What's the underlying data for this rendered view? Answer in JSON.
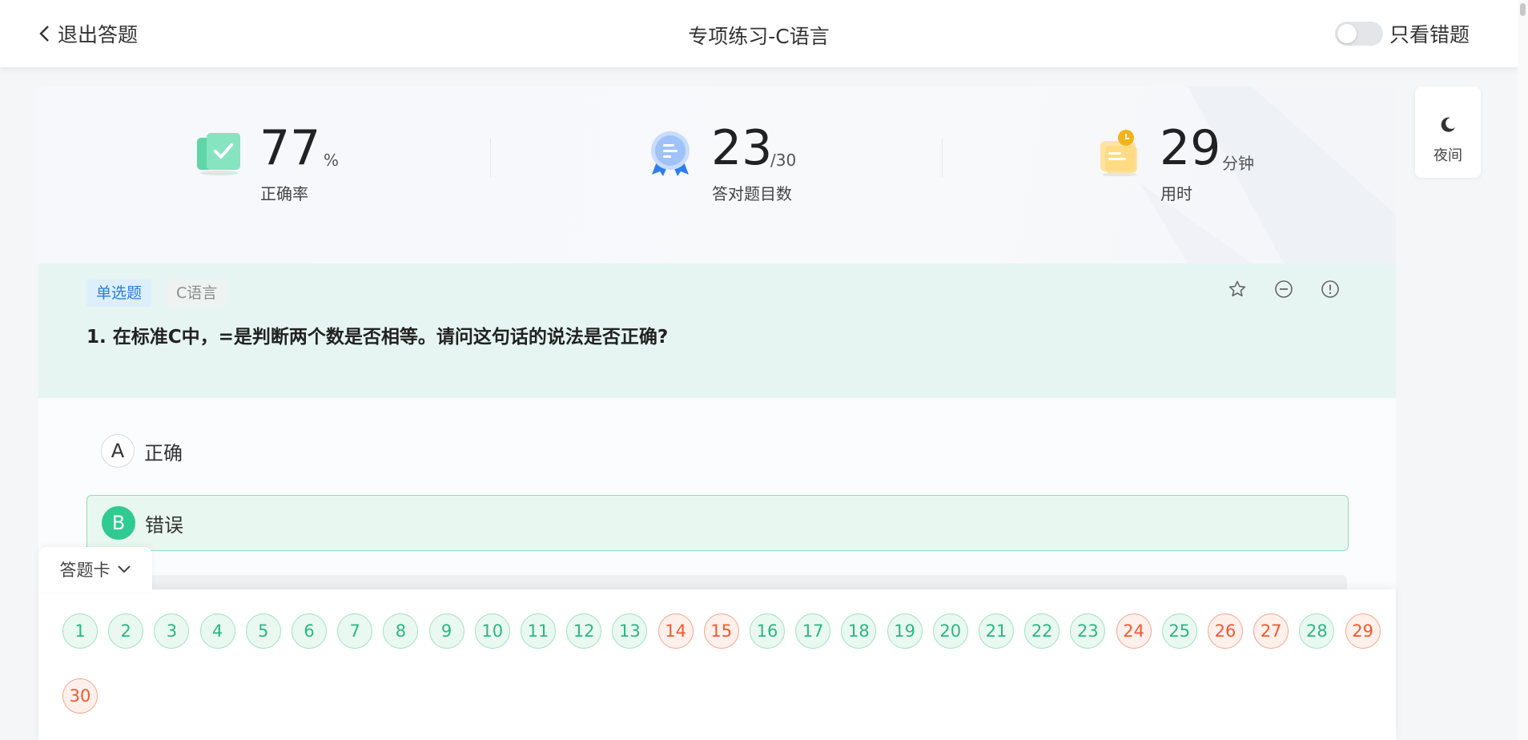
{
  "header": {
    "back_label": "退出答题",
    "title": "专项练习-C语言",
    "toggle_label": "只看错题",
    "toggle_on": false
  },
  "stats": {
    "accuracy": {
      "value": "77",
      "unit": "%",
      "caption": "正确率"
    },
    "correct_count": {
      "value": "23",
      "unit": "/30",
      "caption": "答对题目数"
    },
    "time_used": {
      "value": "29",
      "unit": "分钟",
      "caption": "用时"
    }
  },
  "question": {
    "type_tag": "单选题",
    "subject_tag": "C语言",
    "text": "1. 在标准C中，=是判断两个数是否相等。请问这句话的说法是否正确?",
    "actions": [
      "star-icon",
      "minus-circle-icon",
      "exclamation-circle-icon"
    ]
  },
  "options": [
    {
      "letter": "A",
      "text": "正确",
      "selected": false
    },
    {
      "letter": "B",
      "text": "错误",
      "selected": true
    }
  ],
  "answer_card": {
    "label": "答题卡",
    "numbers": [
      {
        "n": "1",
        "status": "correct"
      },
      {
        "n": "2",
        "status": "correct"
      },
      {
        "n": "3",
        "status": "correct"
      },
      {
        "n": "4",
        "status": "correct"
      },
      {
        "n": "5",
        "status": "correct"
      },
      {
        "n": "6",
        "status": "correct"
      },
      {
        "n": "7",
        "status": "correct"
      },
      {
        "n": "8",
        "status": "correct"
      },
      {
        "n": "9",
        "status": "correct"
      },
      {
        "n": "10",
        "status": "correct"
      },
      {
        "n": "11",
        "status": "correct"
      },
      {
        "n": "12",
        "status": "correct"
      },
      {
        "n": "13",
        "status": "correct"
      },
      {
        "n": "14",
        "status": "wrong"
      },
      {
        "n": "15",
        "status": "wrong"
      },
      {
        "n": "16",
        "status": "correct"
      },
      {
        "n": "17",
        "status": "correct"
      },
      {
        "n": "18",
        "status": "correct"
      },
      {
        "n": "19",
        "status": "correct"
      },
      {
        "n": "20",
        "status": "correct"
      },
      {
        "n": "21",
        "status": "correct"
      },
      {
        "n": "22",
        "status": "correct"
      },
      {
        "n": "23",
        "status": "correct"
      },
      {
        "n": "24",
        "status": "wrong"
      },
      {
        "n": "25",
        "status": "correct"
      },
      {
        "n": "26",
        "status": "wrong"
      },
      {
        "n": "27",
        "status": "wrong"
      },
      {
        "n": "28",
        "status": "correct"
      },
      {
        "n": "29",
        "status": "wrong"
      },
      {
        "n": "30",
        "status": "wrong"
      }
    ]
  },
  "night_mode": {
    "label": "夜间"
  },
  "colors": {
    "accent_green": "#2fcb91",
    "wrong_red": "#ef5a2f",
    "tag_blue": "#2c7fd6"
  }
}
